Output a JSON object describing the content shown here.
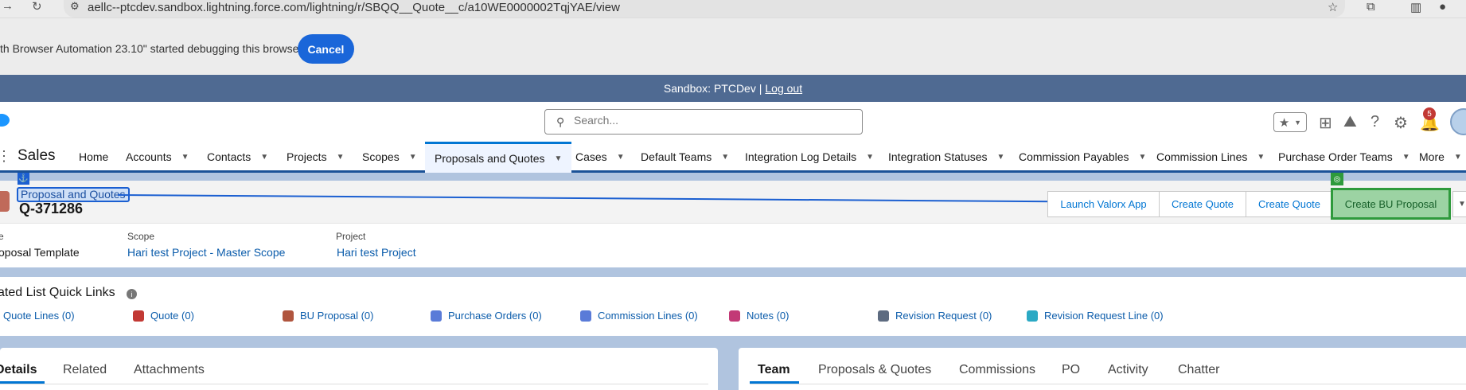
{
  "browser": {
    "url": "aellc--ptcdev.sandbox.lightning.force.com/lightning/r/SBQQ__Quote__c/a10WE0000002TqjYAE/view",
    "debug_message": "th Browser Automation 23.10\" started debugging this browser",
    "cancel_label": "Cancel"
  },
  "sandbox": {
    "label": "Sandbox: PTCDev |",
    "logout": "Log out"
  },
  "header": {
    "search_placeholder": "Search...",
    "notification_count": "5"
  },
  "nav": {
    "app_name": "Sales",
    "tabs": [
      {
        "label": "Home"
      },
      {
        "label": "Accounts"
      },
      {
        "label": "Contacts"
      },
      {
        "label": "Projects"
      },
      {
        "label": "Scopes"
      },
      {
        "label": "Proposals and Quotes"
      },
      {
        "label": "Cases"
      },
      {
        "label": "Default Teams"
      },
      {
        "label": "Integration Log Details"
      },
      {
        "label": "Integration Statuses"
      },
      {
        "label": "Commission Payables"
      },
      {
        "label": "Commission Lines"
      },
      {
        "label": "Purchase Order Teams"
      },
      {
        "label": "More"
      }
    ]
  },
  "record": {
    "object_label": "Proposal and Quotes",
    "name": "Q-371286",
    "actions": {
      "launch": "Launch Valorx App",
      "create_quote_1": "Create Quote",
      "create_quote_2": "Create Quote",
      "create_bu_proposal": "Create BU Proposal"
    },
    "fields": {
      "type_value": "oposal Template",
      "scope_label": "Scope",
      "scope_value": "Hari test Project - Master Scope",
      "project_label": "Project",
      "project_value": "Hari test Project",
      "type_label": "e"
    }
  },
  "related_quick_links": {
    "title": "ated List Quick Links",
    "links": [
      {
        "label": "Quote Lines (0)",
        "color": "#3ba755"
      },
      {
        "label": "Quote (0)",
        "color": "#c23934"
      },
      {
        "label": "BU Proposal (0)",
        "color": "#b0553e"
      },
      {
        "label": "Purchase Orders (0)",
        "color": "#5a7bd8"
      },
      {
        "label": "Commission Lines (0)",
        "color": "#5a7bd8"
      },
      {
        "label": "Notes (0)",
        "color": "#c23976"
      },
      {
        "label": "Revision Request (0)",
        "color": "#5d6b80"
      },
      {
        "label": "Revision Request Line (0)",
        "color": "#2ba9c4"
      }
    ]
  },
  "left_tabs": [
    "Details",
    "Related",
    "Attachments"
  ],
  "right_tabs": [
    "Team",
    "Proposals & Quotes",
    "Commissions",
    "PO",
    "Activity",
    "Chatter"
  ]
}
